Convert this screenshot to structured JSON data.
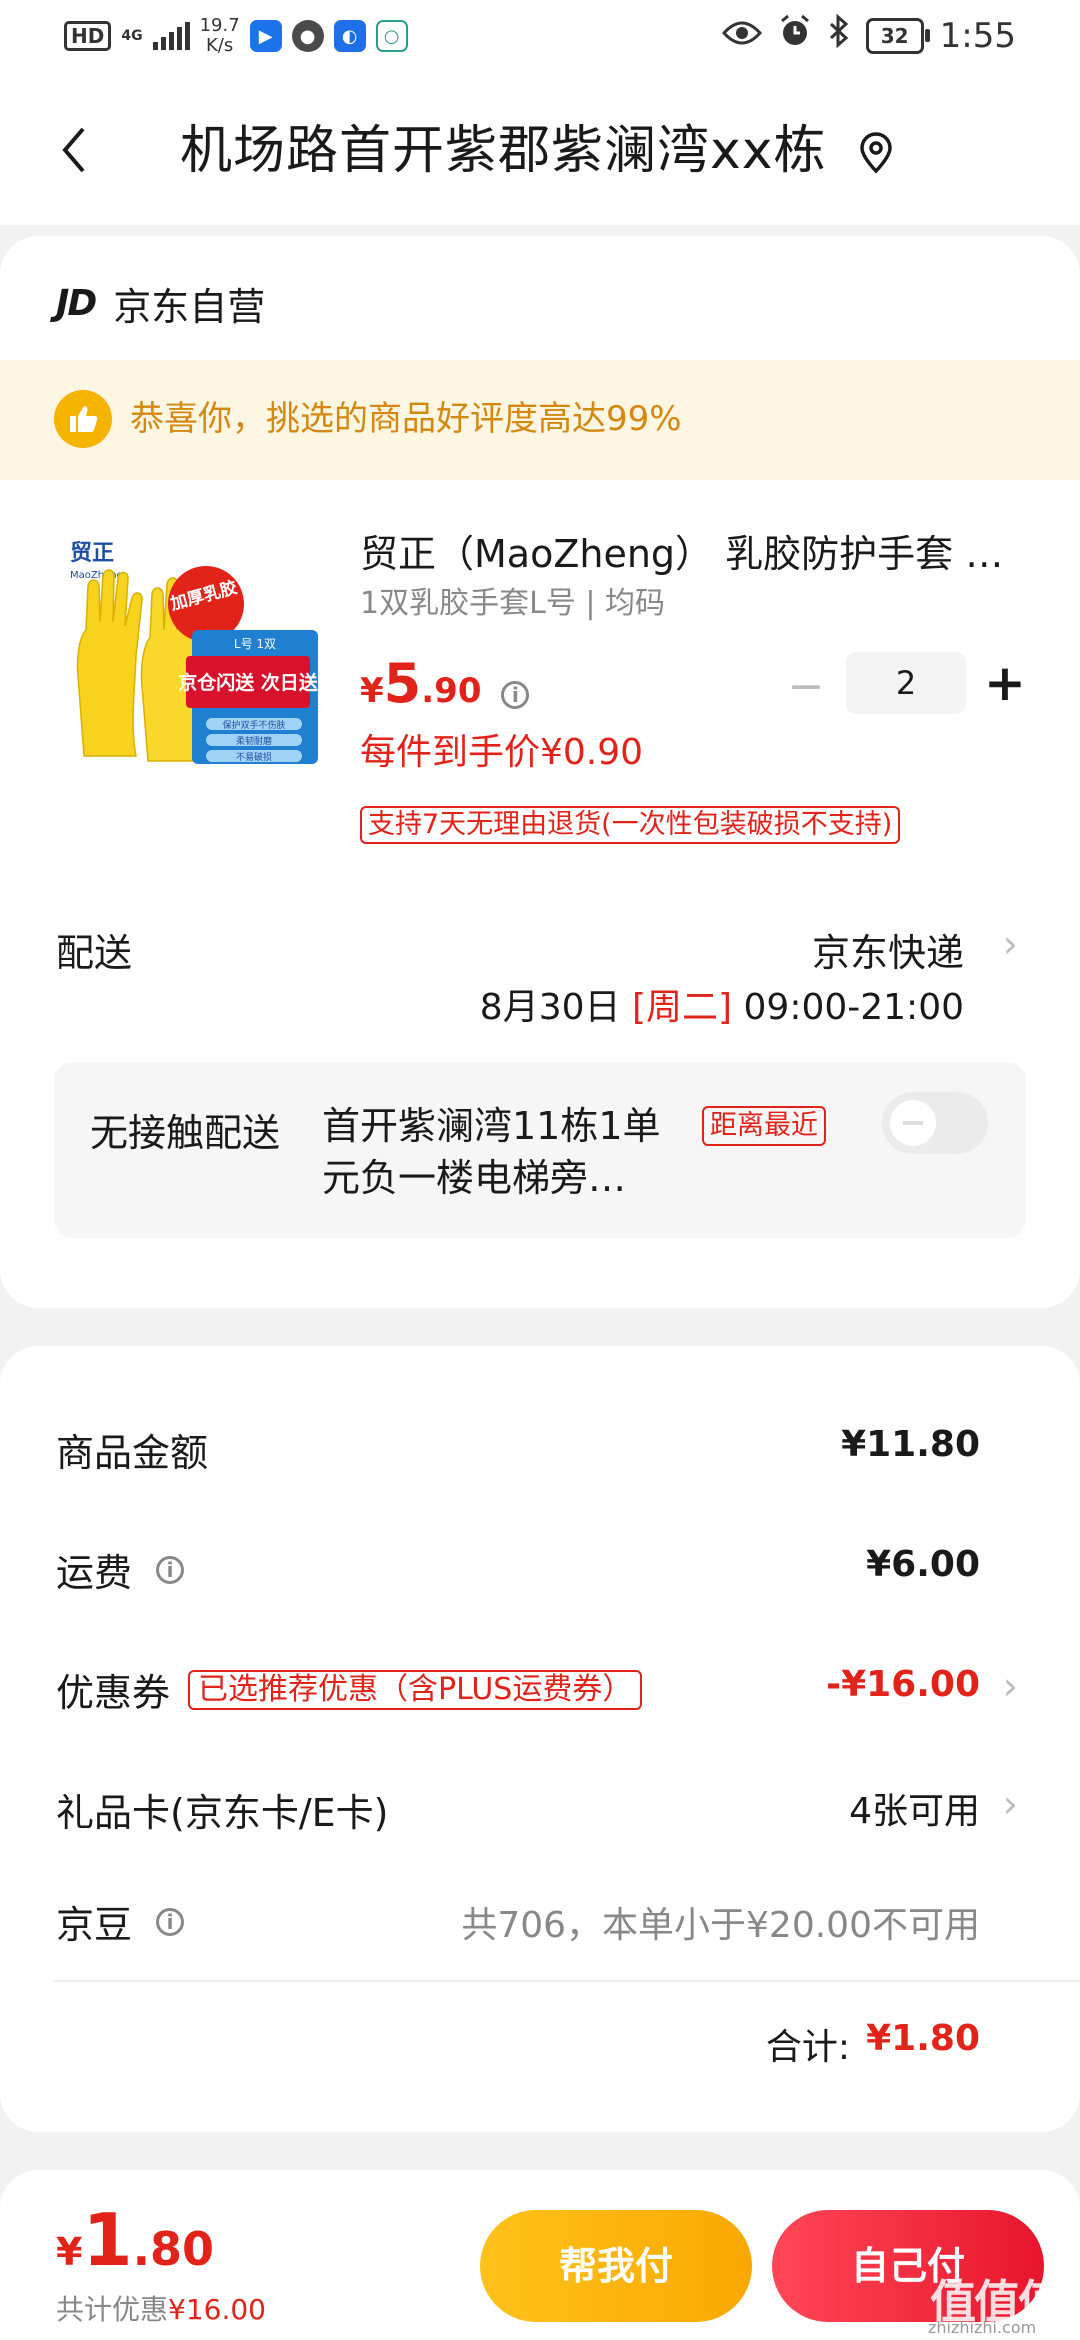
{
  "status_bar": {
    "hd": "HD",
    "network": "4G",
    "speed_value": "19.7",
    "speed_unit": "K/s",
    "battery": "32",
    "time": "1:55"
  },
  "header": {
    "address": "机场路首开紫郡紫澜湾xx栋"
  },
  "shop": {
    "logo": "JD",
    "name": "京东自营"
  },
  "banner": {
    "text": "恭喜你，挑选的商品好评度高达99%"
  },
  "product": {
    "title": "贸正（MaoZheng） 乳胶防护手套 黄色中号",
    "spec": "1双乳胶手套L号 | 均码",
    "price_yen": "¥",
    "price_int": "5",
    "price_dec": ".90",
    "per_price": "每件到手价¥0.90",
    "return_policy": "支持7天无理由退货(一次性包装破损不支持)",
    "quantity": "2",
    "minus": "−",
    "plus": "+",
    "image_brand": "贸正",
    "image_brand_en": "MaoZheng",
    "image_badge": "加厚乳胶",
    "image_box_top": "L号 1双",
    "image_box_main": "京仓闪送 次日送",
    "image_box_lines": [
      "保护双手不伤肤",
      "柔韧耐磨",
      "不易破损"
    ]
  },
  "shipping": {
    "label": "配送",
    "method": "京东快递",
    "date": "8月30日",
    "weekday": "[周二]",
    "time": "09:00-21:00"
  },
  "contactless": {
    "label": "无接触配送",
    "address": "首开紫澜湾11栋1单元负一楼电梯旁…",
    "tag": "距离最近",
    "enabled": false
  },
  "summary": {
    "goods_label": "商品金额",
    "goods_value": "¥11.80",
    "freight_label": "运费",
    "freight_value": "¥6.00",
    "coupon_label": "优惠券",
    "coupon_tag": "已选推荐优惠（含PLUS运费券）",
    "coupon_value": "-¥16.00",
    "giftcard_label": "礼品卡(京东卡/E卡)",
    "giftcard_value": "4张可用",
    "jingdou_label": "京豆",
    "jingdou_value": "共706，本单小于¥20.00不可用",
    "total_label": "合计:",
    "total_value": "¥1.80"
  },
  "bottom_bar": {
    "price_yen": "¥",
    "price_int": "1",
    "price_dec": ".80",
    "save_label": "共计优惠",
    "save_value": "¥16.00",
    "help_pay": "帮我付",
    "self_pay": "自己付",
    "watermark": "值值值",
    "watermark_sub": "zhizhizhi.com"
  },
  "colors": {
    "accent_red": "#e2231a",
    "banner_bg": "#fdf6e2",
    "banner_text": "#d4880f",
    "help_btn": "#f9a800",
    "self_btn": "#e8152c"
  }
}
